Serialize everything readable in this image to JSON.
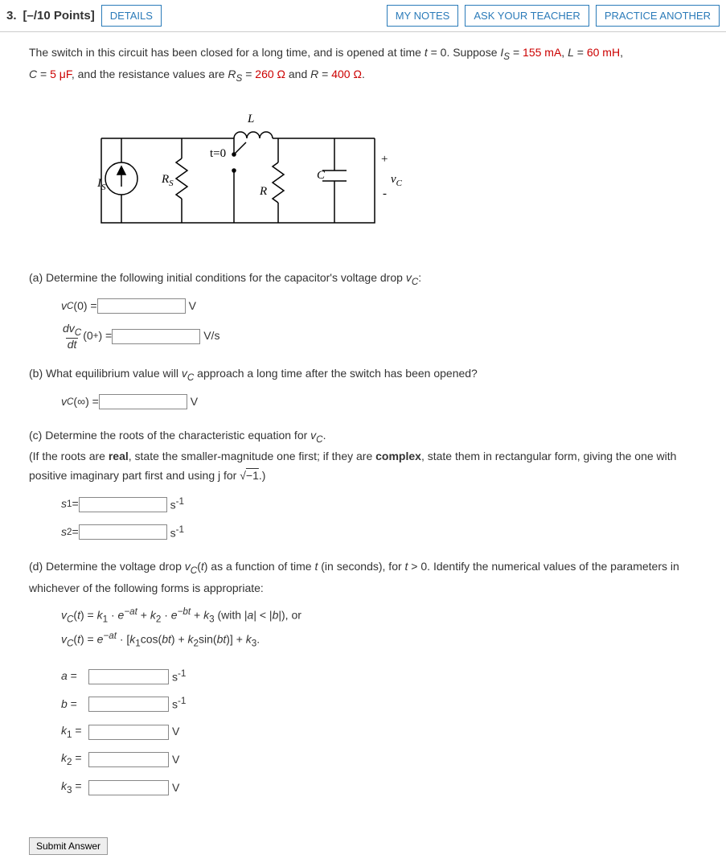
{
  "header": {
    "qnum": "3.",
    "points": "[–/10 Points]",
    "details": "DETAILS",
    "mynotes": "MY NOTES",
    "askteacher": "ASK YOUR TEACHER",
    "practice": "PRACTICE ANOTHER"
  },
  "problem": {
    "intro1a": "The switch in this circuit has been closed for a long time, and is opened at time ",
    "intro1b": " = 0. Suppose ",
    "intro1c": " = ",
    "intro1d": ", ",
    "intro1e": " = ",
    "intro1f": ",",
    "is_val": "155 mA",
    "l_val": "60 mH",
    "intro2a": " = ",
    "intro2b": ", and the resistance values are ",
    "intro2c": " = ",
    "intro2d": " and ",
    "intro2e": " = ",
    "intro2f": ".",
    "c_val": "5 μF",
    "rs_val": "260 Ω",
    "r_val": "400 Ω",
    "var_t": "t",
    "var_Is": "I",
    "var_IsSub": "S",
    "var_L": "L",
    "var_C": "C",
    "var_Rs": "R",
    "var_RsSub": "S",
    "var_R": "R"
  },
  "diagram": {
    "Is": "I",
    "IsSub": "S",
    "Rs": "R",
    "RsSub": "S",
    "L": "L",
    "t0": "t=0",
    "R": "R",
    "C": "C",
    "plus": "+",
    "minus": "-",
    "vc": "v",
    "vcSub": "C"
  },
  "a": {
    "text": "(a) Determine the following initial conditions for the capacitor's voltage drop ",
    "vcLabel": "v",
    "vcSub": "C",
    "colon": ":",
    "vc0": "v",
    "vc0Sub": "C",
    "vc0Arg": "(0) = ",
    "unitV": "V",
    "dvc": "dv",
    "dvcSub": "C",
    "dt": "dt",
    "zeroplus": "(0",
    "sup": "+",
    "close": ") = ",
    "unitVs": "V/s"
  },
  "b": {
    "text1": "(b) What equilibrium value will ",
    "vc": "v",
    "vcSub": "C",
    "text2": " approach a long time after the switch has been opened?",
    "vcinf": "v",
    "vcinfSub": "C",
    "arg": "(∞) = ",
    "unit": "V"
  },
  "c": {
    "text1": "(c) Determine the roots of the characteristic equation for ",
    "vc": "v",
    "vcSub": "C",
    "dot": ".",
    "text2a": "(If the roots are ",
    "real": "real",
    "text2b": ", state the smaller-magnitude one first; if they are ",
    "complex": "complex",
    "text2c": ", state them in rectangular form, giving the one with positive imaginary part first and using j for √",
    "neg1": "−1",
    "text2d": ".)",
    "s1": "s",
    "s1sub": "1",
    "s2": "s",
    "s2sub": "2",
    "eq": " = ",
    "unit": "s",
    "unitSup": "-1"
  },
  "d": {
    "text1a": "(d) Determine the voltage drop ",
    "vc": "v",
    "vcSub": "C",
    "text1b": "(",
    "t": "t",
    "text1c": ") as a function of time ",
    "text1d": " (in seconds), for ",
    "text1e": " > 0. Identify the numerical values of the parameters in whichever of the following forms is appropriate:",
    "eq1": "v",
    "eq1Sub": "C",
    "eq1a": "(",
    "eq1b": ") = ",
    "k1": "k",
    "k1sub": "1",
    "dot": " · ",
    "e": "e",
    "negat": "−at",
    "plus": " + ",
    "k2": "k",
    "k2sub": "2",
    "negbt": "−bt",
    "k3": "k",
    "k3sub": "3",
    "with": " (with |",
    "ava": "a",
    "lt": "| < |",
    "bvb": "b",
    "withend": "|), or",
    "eq2mid": " · [",
    "cos": "cos(",
    "bt": "bt",
    "close": ") + ",
    "sin": "sin(",
    "brk": ")] + ",
    "dot2": ".",
    "la": "a",
    "lb": "b",
    "lk1": "k",
    "lk1s": "1",
    "lk2": "k",
    "lk2s": "2",
    "lk3": "k",
    "lk3s": "3",
    "leq": " = ",
    "unit_s": "s",
    "unit_sSup": "-1",
    "unit_v": "V"
  },
  "submit": "Submit Answer"
}
